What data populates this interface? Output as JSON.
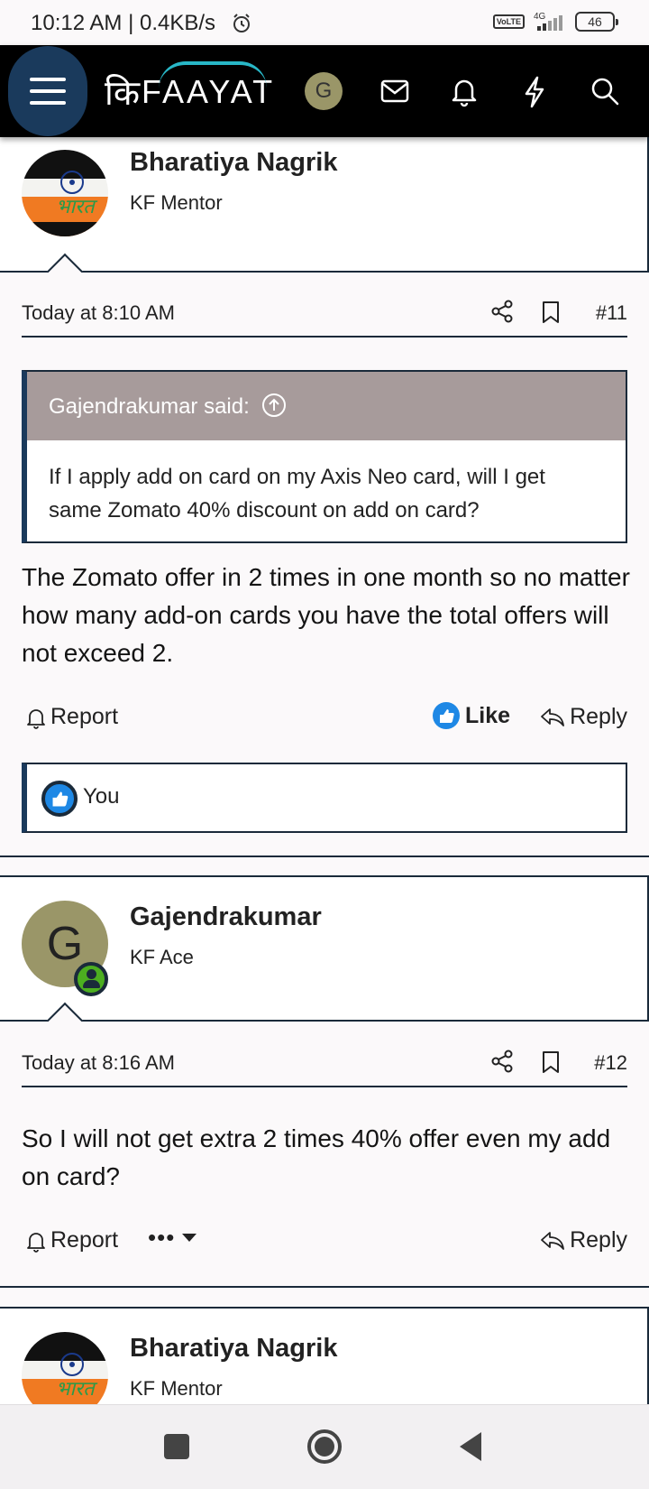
{
  "status_bar": {
    "time_speed": "10:12 AM | 0.4KB/s",
    "network": "4G",
    "volte": "VoLTE",
    "battery": "46"
  },
  "header": {
    "logo_devanagari": "कि",
    "logo_latin": "FAAYAT",
    "user_initial": "G",
    "icons": [
      "menu-icon",
      "mail-icon",
      "bell-icon",
      "lightning-icon",
      "search-icon"
    ]
  },
  "posts": [
    {
      "author": "Bharatiya Nagrik",
      "author_title": "KF Mentor",
      "date": "Today at 8:10 AM",
      "number": "#11",
      "quote": {
        "author": "Gajendrakumar said:",
        "text": "If I apply add on card on my Axis Neo card, will I get same Zomato 40% discount on add on card?"
      },
      "message": "The Zomato offer in 2 times in one month so no matter how many add-on cards you have the total offers will not exceed 2.",
      "actions": {
        "report": "Report",
        "like": "Like",
        "reply": "Reply"
      },
      "reactions": "You"
    },
    {
      "author": "Gajendrakumar",
      "author_title": "KF Ace",
      "avatar_initial": "G",
      "date": "Today at 8:16 AM",
      "number": "#12",
      "message": "So I will not get extra 2 times 40% offer even my add on card?",
      "actions": {
        "report": "Report",
        "more": "•••",
        "reply": "Reply"
      }
    },
    {
      "author": "Bharatiya Nagrik",
      "author_title": "KF Mentor"
    }
  ],
  "avatar_overlay_text": "भारत",
  "colors": {
    "header_bg": "#000000",
    "menu_button": "#1a3a5c",
    "quote_head": "#a79b9b",
    "like_blue": "#1e88e5",
    "avatar_olive": "#9a9668",
    "online_green": "#4caf20"
  }
}
